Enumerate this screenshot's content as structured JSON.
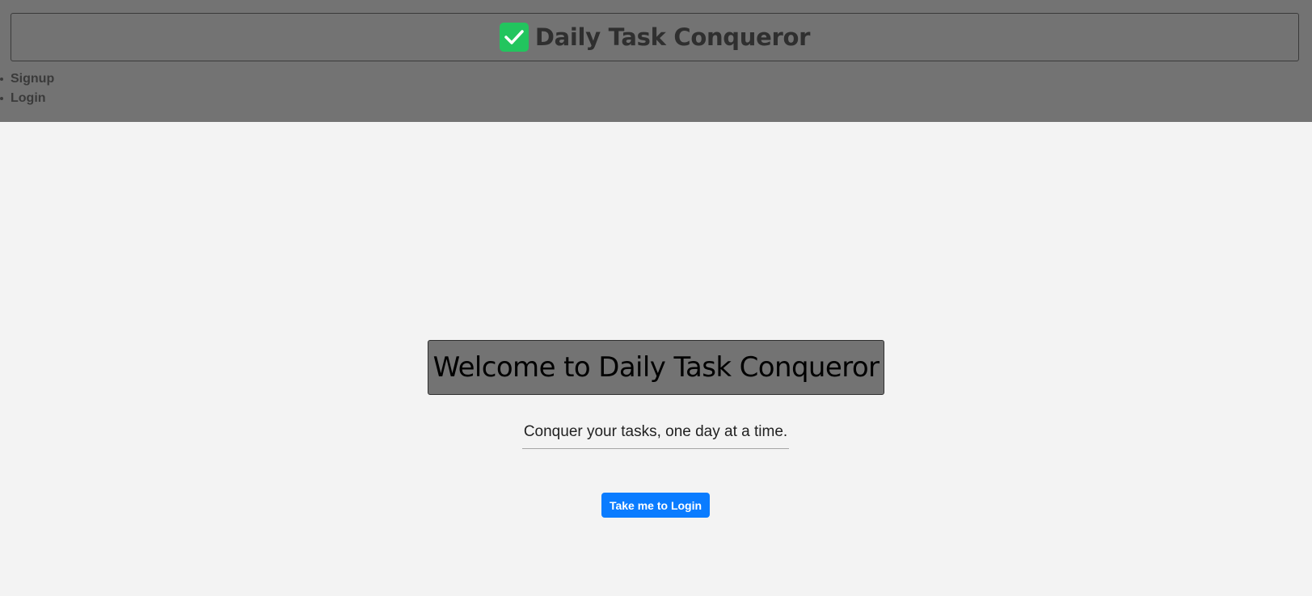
{
  "header": {
    "brand_title": "Daily Task Conqueror",
    "brand_icon": "check-icon",
    "background_color": "#737373"
  },
  "nav": {
    "items": [
      {
        "label": "Signup"
      },
      {
        "label": "Login"
      }
    ]
  },
  "main": {
    "welcome_title": "Welcome to Daily Task Conqueror",
    "tagline": "Conquer your tasks, one day at a time.",
    "cta_label": "Take me to Login",
    "cta_color": "#0a7cff"
  }
}
